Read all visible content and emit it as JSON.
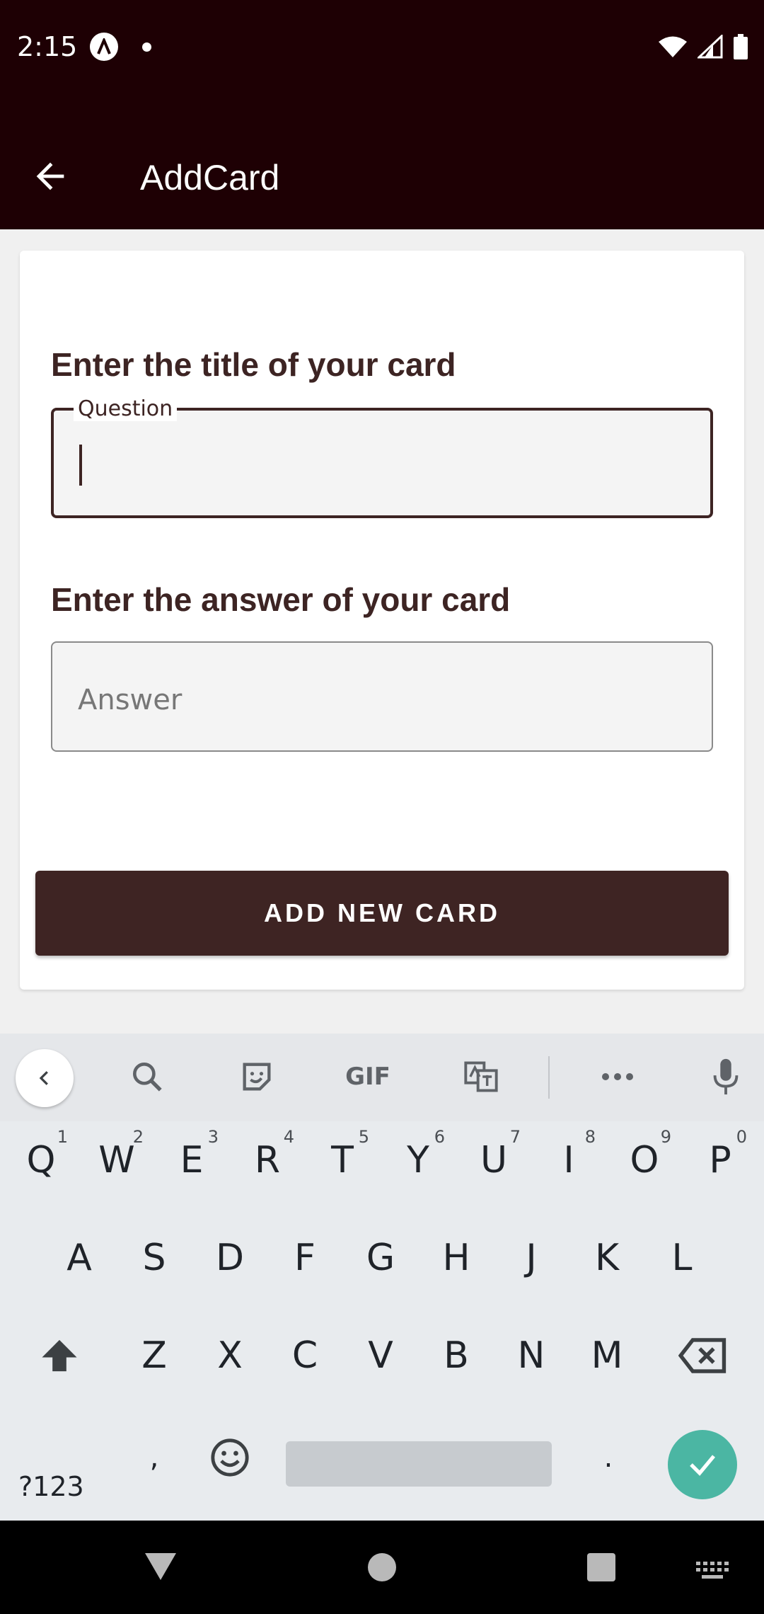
{
  "status_bar": {
    "time": "2:15"
  },
  "app_bar": {
    "title": "AddCard"
  },
  "form": {
    "question_heading": "Enter the title of your card",
    "question_label": "Question",
    "question_value": "",
    "answer_heading": "Enter the answer of your card",
    "answer_placeholder": "Answer",
    "answer_value": "",
    "submit_label": "ADD NEW CARD"
  },
  "keyboard": {
    "toolbar": [
      "back",
      "search-icon",
      "sticker-icon",
      "GIF",
      "translate-icon",
      "more-icon",
      "mic-icon"
    ],
    "gif_label": "GIF",
    "row1": [
      {
        "key": "Q",
        "hint": "1"
      },
      {
        "key": "W",
        "hint": "2"
      },
      {
        "key": "E",
        "hint": "3"
      },
      {
        "key": "R",
        "hint": "4"
      },
      {
        "key": "T",
        "hint": "5"
      },
      {
        "key": "Y",
        "hint": "6"
      },
      {
        "key": "U",
        "hint": "7"
      },
      {
        "key": "I",
        "hint": "8"
      },
      {
        "key": "O",
        "hint": "9"
      },
      {
        "key": "P",
        "hint": "0"
      }
    ],
    "row2": [
      "A",
      "S",
      "D",
      "F",
      "G",
      "H",
      "J",
      "K",
      "L"
    ],
    "row3": [
      "Z",
      "X",
      "C",
      "V",
      "B",
      "N",
      "M"
    ],
    "symbols_label": "?123",
    "comma_label": ",",
    "period_label": "."
  },
  "colors": {
    "app_bar": "#1e0004",
    "accent": "#3e2423",
    "keyboard_enter": "#4bb6a3"
  }
}
